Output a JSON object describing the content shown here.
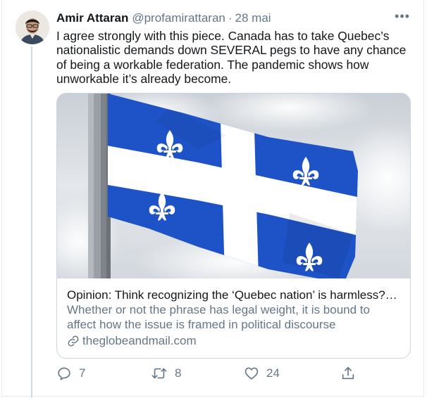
{
  "tweet": {
    "author_name": "Amir Attaran",
    "author_handle": "@profamirattaran",
    "separator": "·",
    "time": "28 mai",
    "more_label": "•••",
    "text": "I agree strongly with this piece.  Canada has to take Quebec’s nationalistic demands down SEVERAL pegs to have any chance of being a workable federation.  The pandemic shows how unworkable it’s already become."
  },
  "card": {
    "title": "Opinion: Think recognizing the ‘Quebec nation’ is harmless? Think again",
    "description": "Whether or not the phrase has legal weight, it is bound to affect how the issue is framed in political discourse",
    "domain": "theglobeandmail.com"
  },
  "actions": {
    "replies": "7",
    "retweets": "8",
    "likes": "24"
  },
  "colors": {
    "text": "#14171a",
    "muted": "#657786",
    "border": "#ccd6dd",
    "flag_blue": "#1e53c8",
    "flag_white": "#ffffff"
  },
  "icons": [
    "avatar",
    "more-icon",
    "link-icon",
    "reply-icon",
    "retweet-icon",
    "like-icon",
    "share-icon",
    "fleur-de-lis-icon"
  ]
}
